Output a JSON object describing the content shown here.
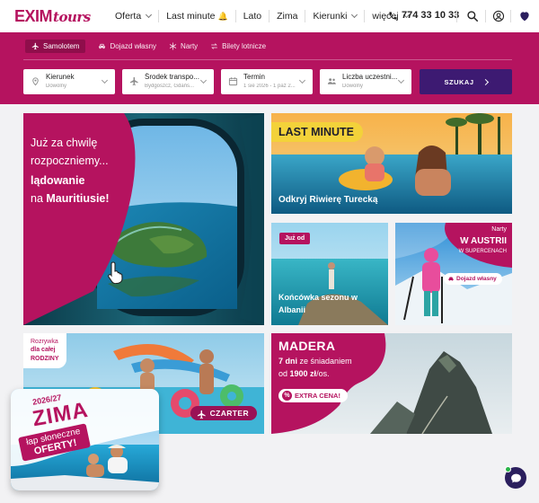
{
  "header": {
    "logo_main": "EXIM",
    "logo_sub": "tours",
    "nav": [
      {
        "label": "Oferta",
        "dropdown": true
      },
      {
        "label": "Last minute",
        "badge_icon": "bell-icon",
        "dropdown": false
      },
      {
        "label": "Lato",
        "dropdown": false
      },
      {
        "label": "Zima",
        "dropdown": false
      },
      {
        "label": "Kierunki",
        "dropdown": true
      },
      {
        "label": "więcej",
        "dropdown": true
      }
    ],
    "phone": "774 33 10 33",
    "icons": [
      "search-icon",
      "user-icon",
      "heart-icon"
    ]
  },
  "search": {
    "tabs": [
      {
        "label": "Samolotem",
        "icon": "plane-icon",
        "active": true
      },
      {
        "label": "Dojazd własny",
        "icon": "car-icon",
        "active": false
      },
      {
        "label": "Narty",
        "icon": "snowflake-icon",
        "active": false
      },
      {
        "label": "Bilety lotnicze",
        "icon": "swap-icon",
        "active": false
      }
    ],
    "fields": [
      {
        "label": "Kierunek",
        "value": "Dowolny",
        "icon": "location-pin-icon"
      },
      {
        "label": "Środek transpo...",
        "value": "Bydgoszcz, Gdańs...",
        "icon": "plane-icon"
      },
      {
        "label": "Termin",
        "value": "1 sie 2026 - 1 paź 2...",
        "icon": "calendar-icon"
      },
      {
        "label": "Liczba uczestni...",
        "value": "Dowolny",
        "icon": "people-icon"
      }
    ],
    "button_label": "SZUKAJ"
  },
  "tiles": {
    "mauritius": {
      "line1": "Już za chwilę",
      "line2": "rozpoczniemy...",
      "line3": "lądowanie",
      "line4_pre": "na",
      "line4_bold": "Mauritiusie!"
    },
    "last_minute": {
      "badge": "LAST MINUTE",
      "caption": "Odkryj Riwierę Turecką"
    },
    "albania": {
      "badge": "Już od",
      "caption_line1": "Końcówka sezonu w",
      "caption_line2": "Albanii"
    },
    "austria": {
      "line1": "Narty",
      "line2": "W AUSTRII",
      "line3": "W SUPERCENACH",
      "pill": "Dojazd własny"
    },
    "family": {
      "line1": "Rozrywka",
      "line2": "dla całej",
      "line3": "RODZINY",
      "button": "CZARTER"
    },
    "madera": {
      "title": "MADERA",
      "line2_bold": "7 dni",
      "line2_rest": "ze śniadaniem",
      "line3_pre": "od",
      "line3_bold": "1900 zł",
      "line3_post": "/os.",
      "button": "EXTRA CENA!"
    }
  },
  "popup": {
    "year": "2026/27",
    "title": "ZIMA",
    "line1": "łap słoneczne",
    "line2": "OFERTY!"
  },
  "colors": {
    "brand": "#b5135f",
    "dark_purple": "#3d1a72",
    "last_minute_yellow": "#f3d23a"
  }
}
